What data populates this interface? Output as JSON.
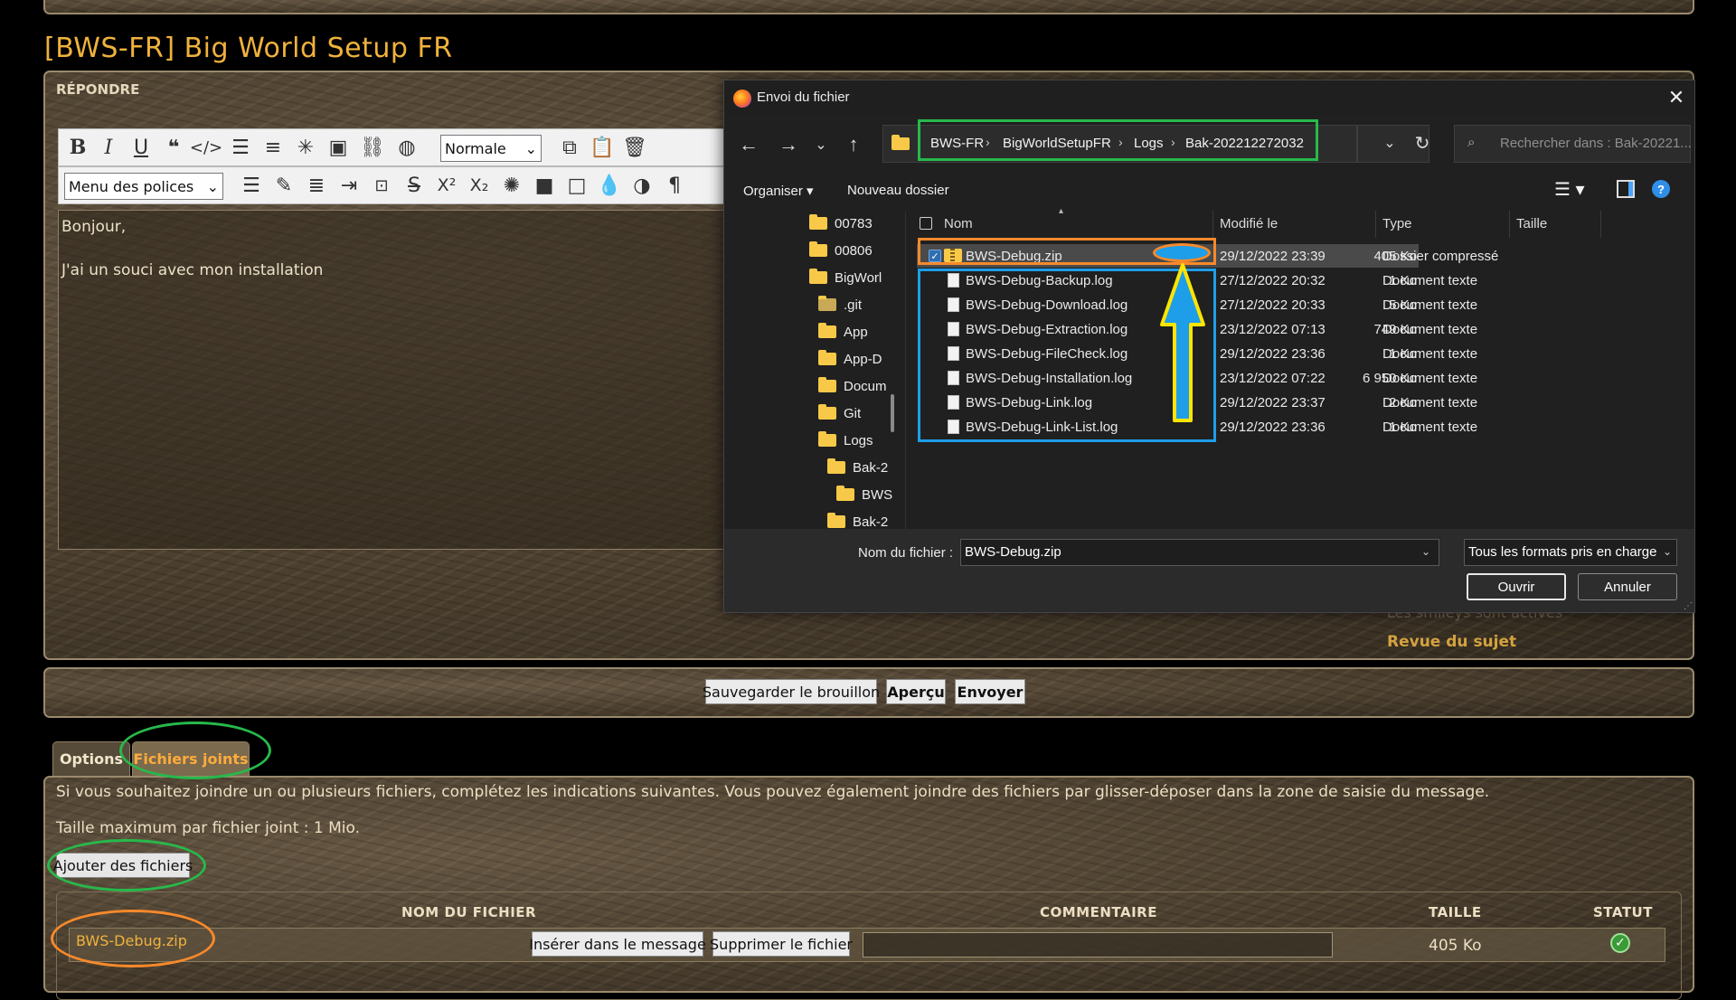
{
  "page": {
    "title": "[BWS-FR] Big World Setup FR",
    "reply_label": "RÉPONDRE"
  },
  "editor": {
    "toolbar_row1": [
      "bold",
      "italic",
      "underline",
      "quote",
      "code",
      "bulleted-list",
      "numbered-list",
      "list-item",
      "image",
      "link",
      "color"
    ],
    "font_size_select": "Normale",
    "font_menu_select": "Menu des polices",
    "body_lines": [
      "Bonjour,",
      "",
      "J'ai un souci avec mon installation"
    ]
  },
  "side": {
    "smilies_note": "Les smileys sont activés",
    "review_link": "Revue du sujet"
  },
  "actions": {
    "save_draft": "Sauvegarder le brouillon",
    "preview": "Aperçu",
    "submit": "Envoyer"
  },
  "tabs": {
    "options": "Options",
    "attachments": "Fichiers joints"
  },
  "attachments": {
    "info": "Si vous souhaitez joindre un ou plusieurs fichiers, complétez les indications suivantes. Vous pouvez également joindre des fichiers par glisser-déposer dans la zone de saisie du message.",
    "max_size": "Taille maximum par fichier joint : 1 Mio.",
    "add_button": "Ajouter des fichiers",
    "columns": [
      "NOM DU FICHIER",
      "COMMENTAIRE",
      "TAILLE",
      "STATUT"
    ],
    "file": {
      "name": "BWS-Debug.zip",
      "insert_button": "Insérer dans le message",
      "delete_button": "Supprimer le fichier",
      "size": "405 Ko"
    }
  },
  "dialog": {
    "title": "Envoi du fichier",
    "breadcrumb": [
      "BWS-FR",
      "BigWorldSetupFR",
      "Logs",
      "Bak-202212272032"
    ],
    "search_placeholder": "Rechercher dans : Bak-20221...",
    "organize": "Organiser",
    "new_folder": "Nouveau dossier",
    "tree": [
      "00783",
      "00806",
      "BigWorl",
      ".git",
      "App",
      "App-D",
      "Docum",
      "Git",
      "Logs",
      "Bak-2",
      "BWS",
      "Bak-2"
    ],
    "columns": [
      "Nom",
      "Modifié le",
      "Type",
      "Taille"
    ],
    "files": [
      {
        "name": "BWS-Debug.zip",
        "modified": "29/12/2022 23:39",
        "type": "Dossier compressé",
        "size": "405 Ko",
        "icon": "zip-folder-icon"
      },
      {
        "name": "BWS-Debug-Backup.log",
        "modified": "27/12/2022 20:32",
        "type": "Document texte",
        "size": "1 Ko",
        "icon": "text-file-icon"
      },
      {
        "name": "BWS-Debug-Download.log",
        "modified": "27/12/2022 20:33",
        "type": "Document texte",
        "size": "5 Ko",
        "icon": "text-file-icon"
      },
      {
        "name": "BWS-Debug-Extraction.log",
        "modified": "23/12/2022 07:13",
        "type": "Document texte",
        "size": "749 Ko",
        "icon": "text-file-icon"
      },
      {
        "name": "BWS-Debug-FileCheck.log",
        "modified": "29/12/2022 23:36",
        "type": "Document texte",
        "size": "1 Ko",
        "icon": "text-file-icon"
      },
      {
        "name": "BWS-Debug-Installation.log",
        "modified": "23/12/2022 07:22",
        "type": "Document texte",
        "size": "6 950 Ko",
        "icon": "text-file-icon"
      },
      {
        "name": "BWS-Debug-Link.log",
        "modified": "29/12/2022 23:37",
        "type": "Document texte",
        "size": "2 Ko",
        "icon": "text-file-icon"
      },
      {
        "name": "BWS-Debug-Link-List.log",
        "modified": "29/12/2022 23:36",
        "type": "Document texte",
        "size": "1 Ko",
        "icon": "text-file-icon"
      }
    ],
    "filename_label": "Nom du fichier :",
    "filename_value": "BWS-Debug.zip",
    "filetype": "Tous les formats pris en charge",
    "open": "Ouvrir",
    "cancel": "Annuler"
  },
  "colors": {
    "title_gold": "#f0b23c",
    "annot_green": "#27b94b",
    "annot_orange": "#f7892b",
    "annot_blue": "#1e9ee8",
    "annot_yellow": "#ffe500"
  }
}
